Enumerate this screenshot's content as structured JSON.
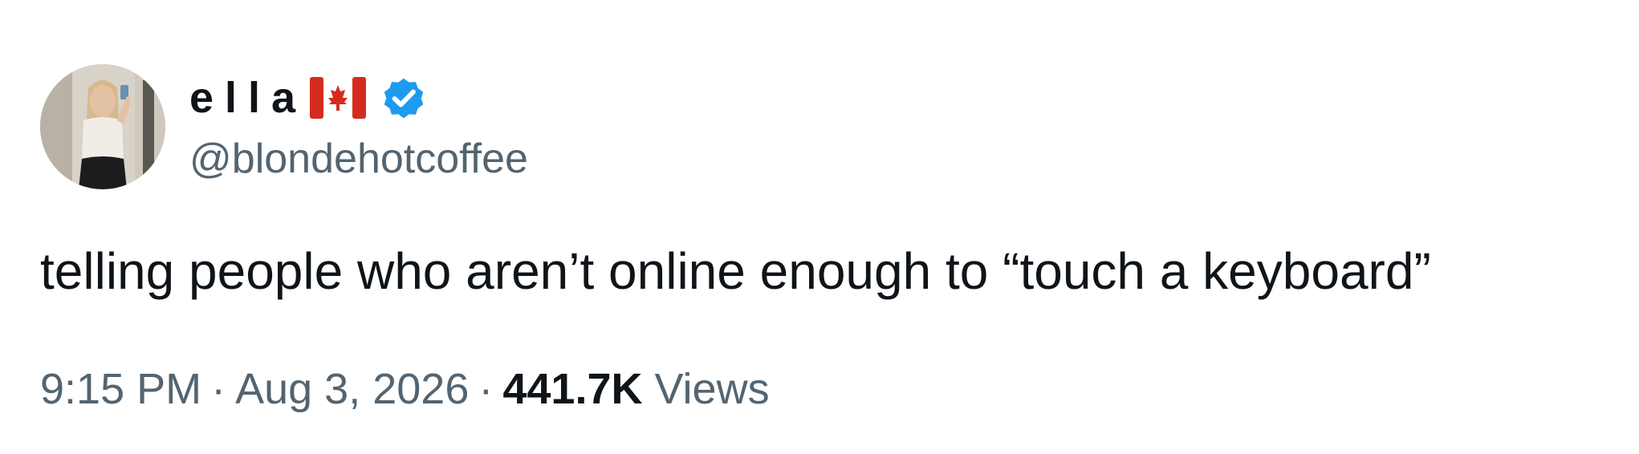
{
  "author": {
    "display_name": "ella",
    "flag_icon": "canada-flag-icon",
    "verified_icon": "verified-badge-icon",
    "handle": "@blondehotcoffee",
    "avatar_icon": "profile-photo"
  },
  "tweet": {
    "text": "telling people who aren’t online enough to “touch a keyboard”"
  },
  "meta": {
    "time": "9:15 PM",
    "separator": "·",
    "date": "Aug 3, 2026",
    "views_count": "441.7K",
    "views_label": "Views"
  },
  "colors": {
    "text_primary": "#0f1419",
    "text_secondary": "#536471",
    "verified_blue": "#1d9bf0",
    "flag_red": "#d52b1e"
  }
}
